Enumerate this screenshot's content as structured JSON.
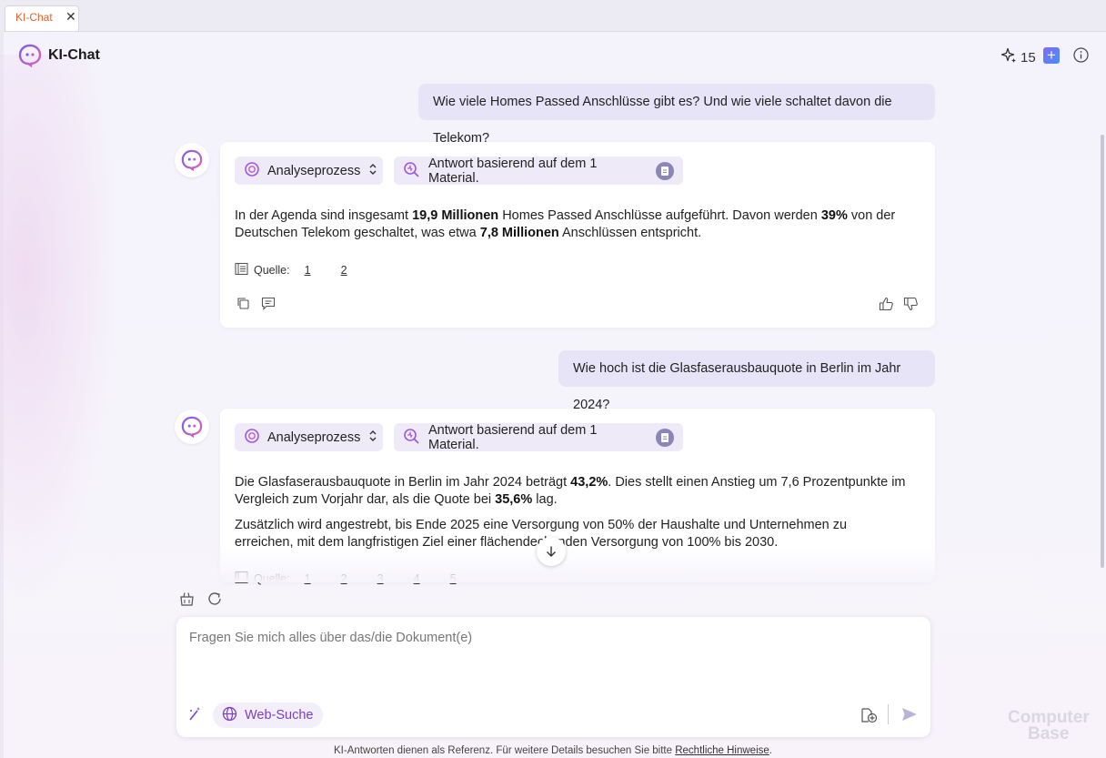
{
  "tab": {
    "title": "KI-Chat",
    "close": "✕"
  },
  "header": {
    "title": "KI-Chat",
    "credits": "15"
  },
  "messages": [
    {
      "question": "Wie viele Homes Passed Anschlüsse gibt es? Und wie viele schaltet davon die Telekom?",
      "analysis_label": "Analyseprozess",
      "material_label": "Antwort basierend auf dem 1 Material.",
      "paragraphs": [
        [
          {
            "t": "In der Agenda sind insgesamt ",
            "b": false
          },
          {
            "t": "19,9 Millionen",
            "b": true
          },
          {
            "t": " Homes Passed Anschlüsse aufgeführt. Davon werden ",
            "b": false
          },
          {
            "t": "39%",
            "b": true
          },
          {
            "t": " von der Deutschen Telekom geschaltet, was etwa ",
            "b": false
          },
          {
            "t": "7,8 Millionen",
            "b": true
          },
          {
            "t": " Anschlüssen entspricht.",
            "b": false
          }
        ]
      ],
      "sources_label": "Quelle:",
      "sources": [
        "1",
        "2"
      ]
    },
    {
      "question": "Wie hoch ist die Glasfaserausbauquote in Berlin im Jahr 2024?",
      "analysis_label": "Analyseprozess",
      "material_label": "Antwort basierend auf dem 1 Material.",
      "paragraphs": [
        [
          {
            "t": "Die Glasfaserausbauquote in Berlin im Jahr 2024 beträgt ",
            "b": false
          },
          {
            "t": "43,2%",
            "b": true
          },
          {
            "t": ". Dies stellt einen Anstieg um 7,6 Prozentpunkte im Vergleich zum Vorjahr dar, als die Quote bei ",
            "b": false
          },
          {
            "t": "35,6%",
            "b": true
          },
          {
            "t": " lag.",
            "b": false
          }
        ],
        [
          {
            "t": "Zusätzlich wird angestrebt, bis Ende 2025 eine Versorgung von 50% der Haushalte und Unternehmen zu erreichen, mit dem langfristigen Ziel einer flächendeckenden Versorgung von 100% bis 2030.",
            "b": false
          }
        ]
      ],
      "sources_label": "Quelle:",
      "sources": [
        "1",
        "2",
        "3",
        "4",
        "5"
      ]
    }
  ],
  "composer": {
    "placeholder": "Fragen Sie mich alles über das/die Dokument(e)",
    "web_search_label": "Web-Suche"
  },
  "footer": {
    "text": "KI-Antworten dienen als Referenz. Für weitere Details besuchen Sie bitte ",
    "link": "Rechtliche Hinweise",
    "end": "."
  },
  "watermark": {
    "line1": "Computer",
    "line2": "Base"
  },
  "colors": {
    "accent": "#7c3fc6",
    "tab_title": "#e0622a",
    "user_bubble": "#e7e4f8"
  }
}
